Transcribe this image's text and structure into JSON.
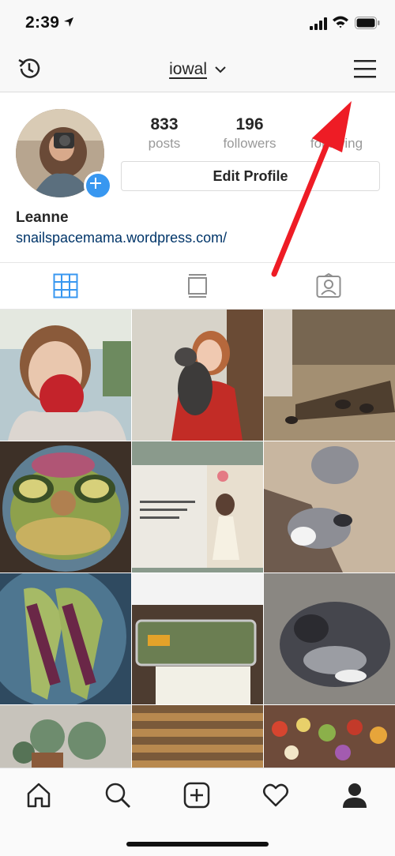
{
  "status_bar": {
    "time": "2:39"
  },
  "nav": {
    "username": "iowal"
  },
  "profile": {
    "posts_count": "833",
    "posts_label": "posts",
    "followers_count": "196",
    "followers_label": "followers",
    "following_label": "following",
    "edit_button": "Edit Profile",
    "name": "Leanne",
    "website": "snailspacemama.wordpress.com/"
  },
  "tabs": [
    "grid-icon",
    "feed-icon",
    "tagged-icon"
  ],
  "grid_photos": [
    "girl holding apple in library",
    "girl hugging dog in kitchen",
    "chickens in yard",
    "salad with avocado",
    "open picture book",
    "dogs on floor",
    "lettuce wraps on plate",
    "salad in glass dish with note",
    "sleeping puppy",
    "plants in pots",
    "wooden boards",
    "roasted vegetables"
  ],
  "bottom_nav": [
    "home-icon",
    "search-icon",
    "add-post-icon",
    "heart-icon",
    "profile-icon"
  ],
  "colors": {
    "accent": "#3897f0",
    "link": "#003569",
    "arrow": "#ee1c25"
  }
}
